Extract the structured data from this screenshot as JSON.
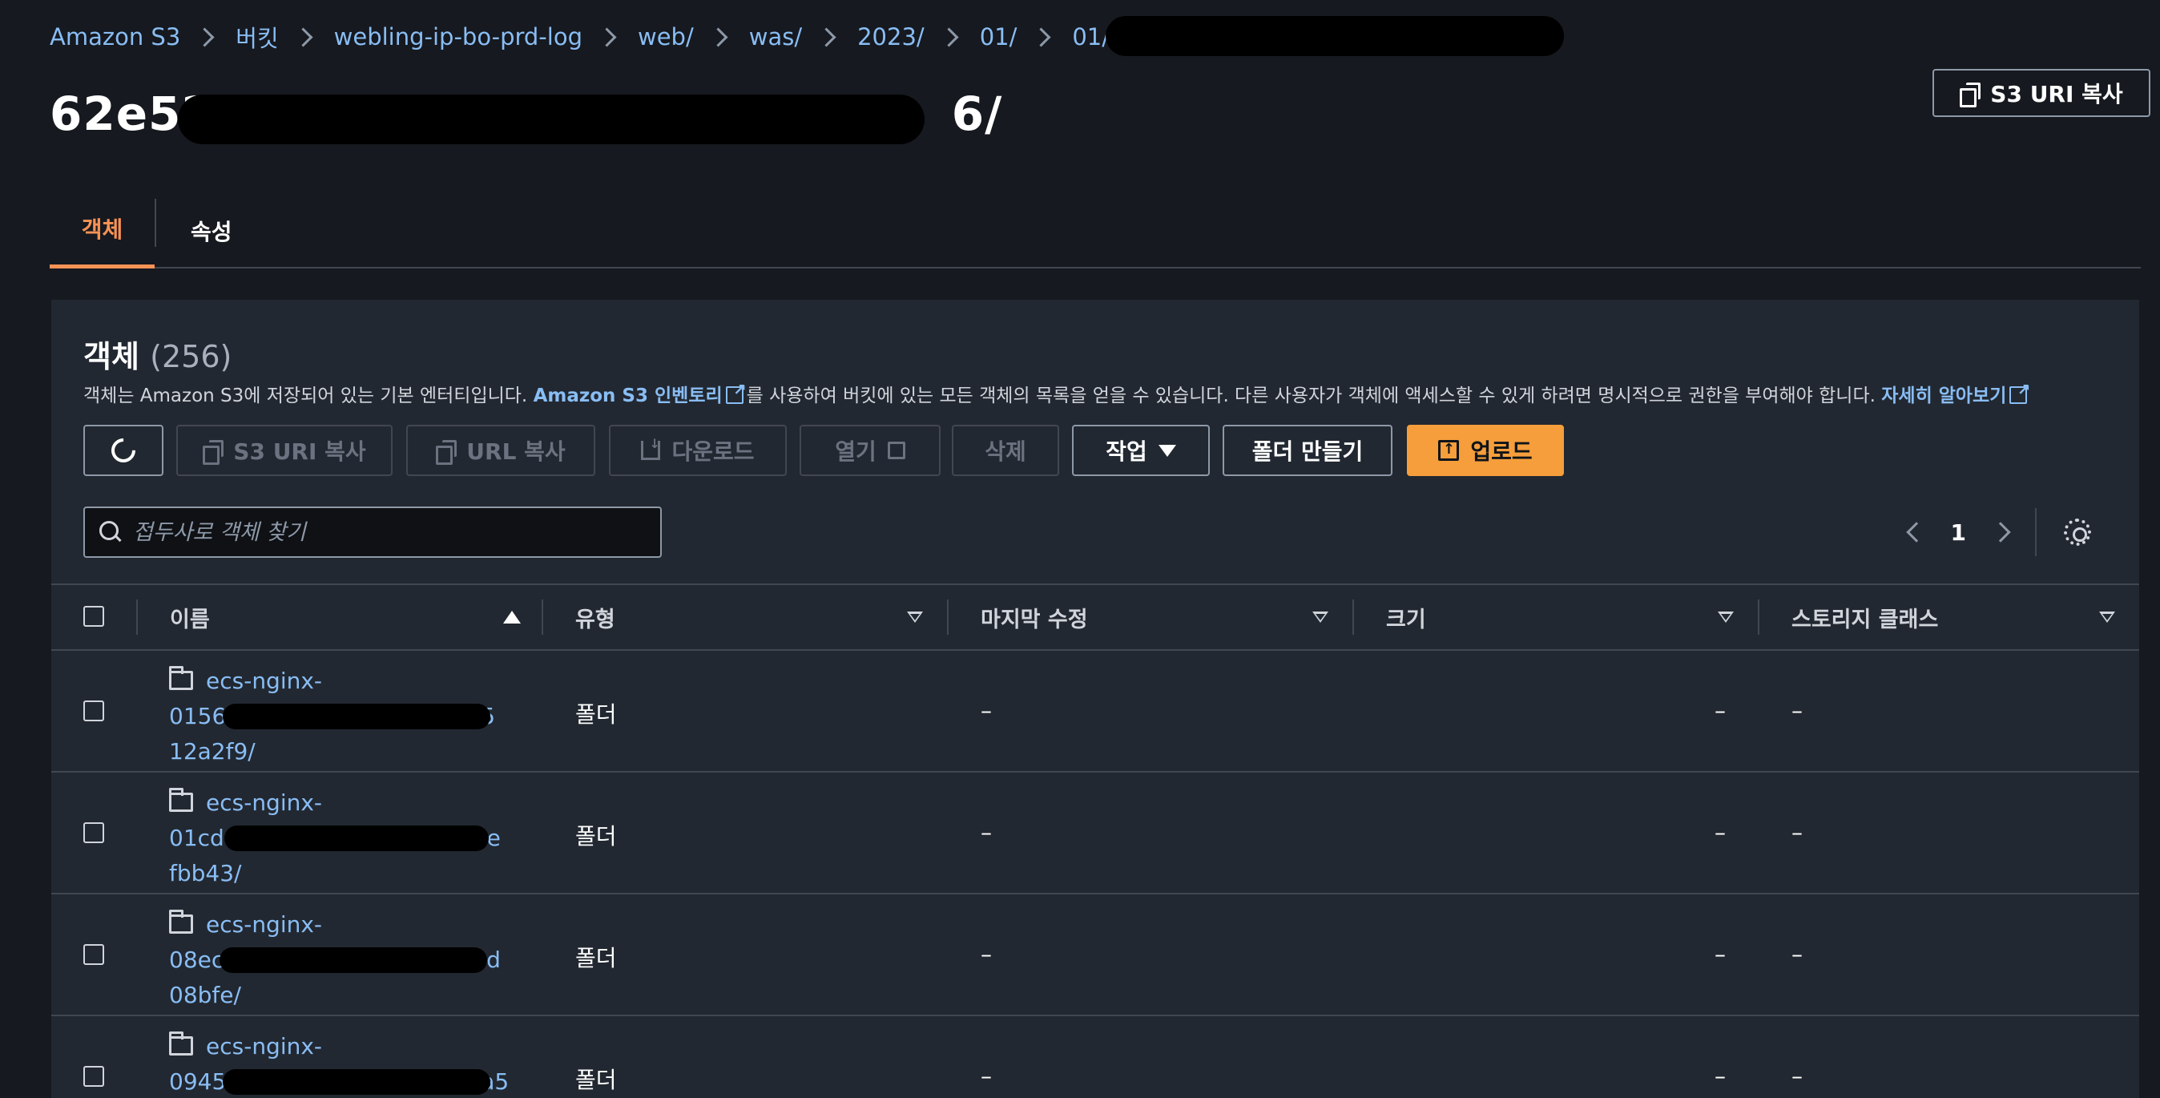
{
  "breadcrumb": {
    "items": [
      "Amazon S3",
      "버킷",
      "webling-ip-bo-prd-log",
      "web/",
      "was/",
      "2023/",
      "01/",
      "01/"
    ],
    "current": "62"
  },
  "page_title": "62e52",
  "page_title_tail": "6/",
  "header_copy_uri_label": "S3 URI 복사",
  "tabs": [
    {
      "label": "객체",
      "active": true
    },
    {
      "label": "속성",
      "active": false
    }
  ],
  "objects": {
    "title": "객체",
    "count": "(256)",
    "desc_part1": "객체는 Amazon S3에 저장되어 있는 기본 엔터티입니다.",
    "desc_link1": "Amazon S3 인벤토리",
    "desc_part2": "를 사용하여 버킷에 있는 모든 객체의 목록을 얻을 수 있습니다. 다른 사용자가 객체에 액세스할 수 있게 하려면 명시적으로 권한을 부여해야 합니다.",
    "desc_link2": "자세히 알아보기"
  },
  "toolbar": {
    "copy_s3_uri": "S3 URI 복사",
    "copy_url": "URL 복사",
    "download": "다운로드",
    "open": "열기",
    "delete": "삭제",
    "actions": "작업",
    "create_folder": "폴더 만들기",
    "upload": "업로드"
  },
  "search": {
    "placeholder": "접두사로 객체 찾기",
    "value": ""
  },
  "pagination": {
    "page": "1"
  },
  "table": {
    "columns": [
      "이름",
      "유형",
      "마지막 수정",
      "크기",
      "스토리지 클래스"
    ],
    "rows": [
      {
        "line1": "ecs-nginx-",
        "line2a": "0156",
        "line2b": "5",
        "line3": "12a2f9/",
        "type": "폴더",
        "modified": "–",
        "size": "–",
        "storage": "–"
      },
      {
        "line1": "ecs-nginx-",
        "line2a": "01cd",
        "line2b": "8e",
        "line3": "fbb43/",
        "type": "폴더",
        "modified": "–",
        "size": "–",
        "storage": "–"
      },
      {
        "line1": "ecs-nginx-",
        "line2a": "08ec",
        "line2b": "5d",
        "line3": "08bfe/",
        "type": "폴더",
        "modified": "–",
        "size": "–",
        "storage": "–"
      },
      {
        "line1": "ecs-nginx-",
        "line2a": "0945",
        "line2b": "a5",
        "line3": "",
        "type": "폴더",
        "modified": "–",
        "size": "–",
        "storage": "–"
      }
    ]
  },
  "colors": {
    "accent": "#f89256",
    "link": "#89bdf4",
    "primary_button": "#f59e3b",
    "background": "#16191f",
    "panel": "#222831"
  }
}
